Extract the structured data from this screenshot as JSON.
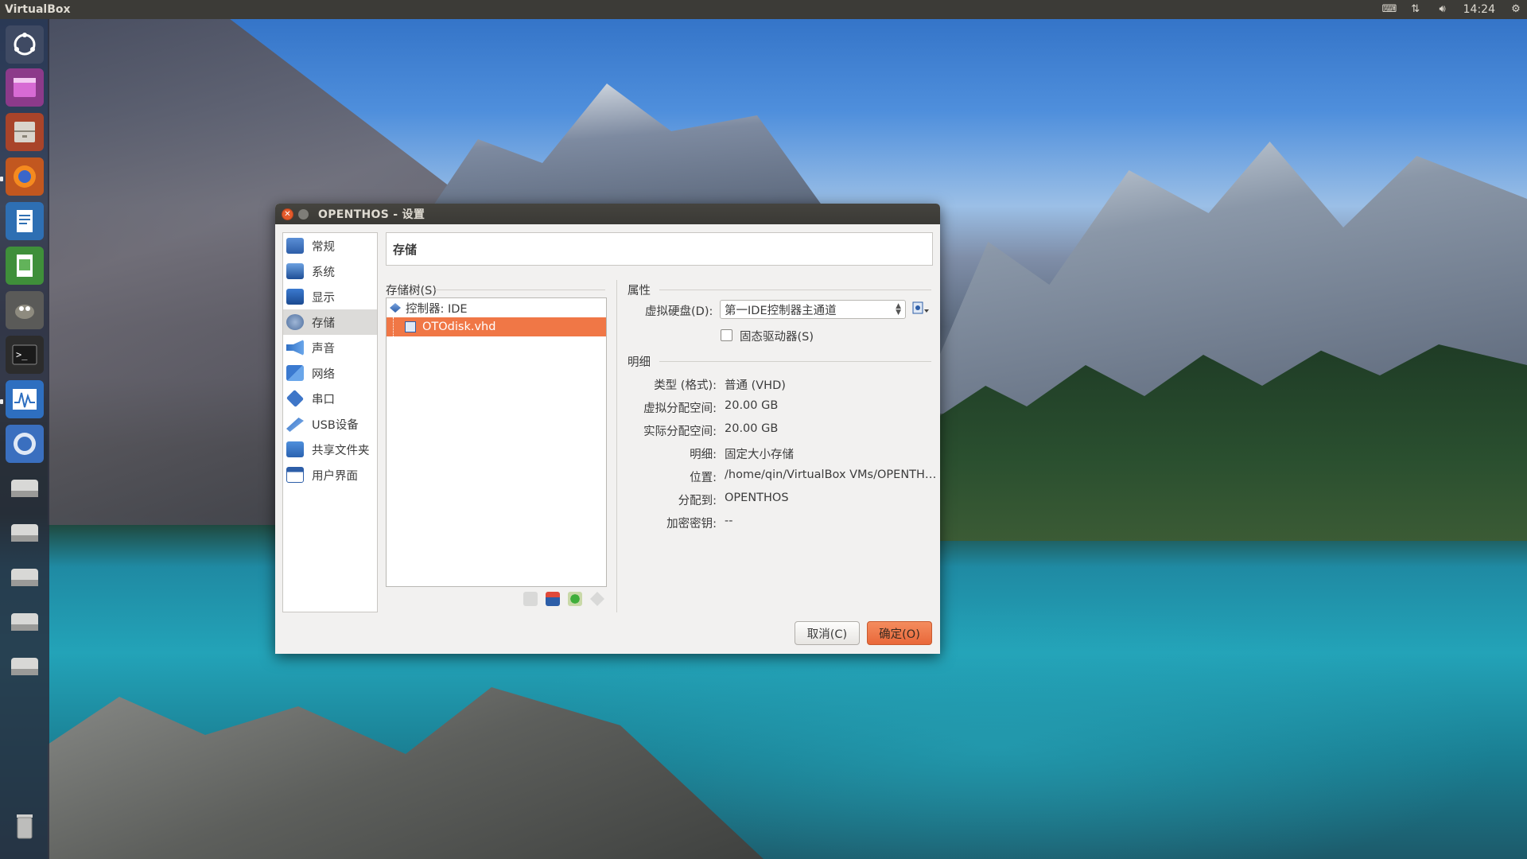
{
  "top_panel": {
    "app_name": "VirtualBox",
    "clock": "14:24"
  },
  "dialog": {
    "title": "OPENTHOS - 设置",
    "heading": "存储",
    "categories": [
      "常规",
      "系统",
      "显示",
      "存储",
      "声音",
      "网络",
      "串口",
      "USB设备",
      "共享文件夹",
      "用户界面"
    ],
    "selected_category": "存储",
    "storage_tree_label": "存储树(S)",
    "tree": {
      "controller": "控制器: IDE",
      "disk": "OTOdisk.vhd"
    },
    "attributes_label": "属性",
    "virtual_disk_label": "虚拟硬盘(D):",
    "virtual_disk_value": "第一IDE控制器主通道",
    "ssd_label": "固态驱动器(S)",
    "details_label": "明细",
    "details": [
      {
        "key": "类型 (格式):",
        "value": "普通 (VHD)"
      },
      {
        "key": "虚拟分配空间:",
        "value": "20.00 GB"
      },
      {
        "key": "实际分配空间:",
        "value": "20.00 GB"
      },
      {
        "key": "明细:",
        "value": "固定大小存储"
      },
      {
        "key": "位置:",
        "value": "/home/qin/VirtualBox VMs/OPENTH…"
      },
      {
        "key": "分配到:",
        "value": "OPENTHOS"
      },
      {
        "key": "加密密钥:",
        "value": "--"
      }
    ],
    "cancel_label": "取消(C)",
    "ok_label": "确定(O)"
  },
  "colors": {
    "selection": "#f07746",
    "panel": "#3c3b37",
    "ok_button": "#e9683a"
  }
}
